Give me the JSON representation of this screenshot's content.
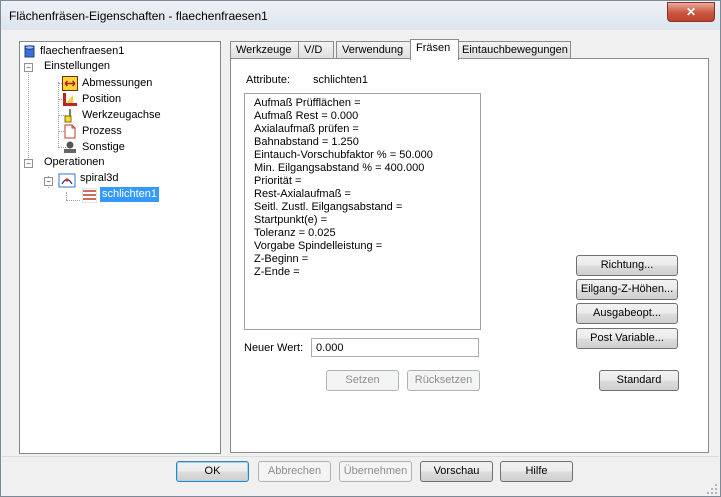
{
  "window": {
    "title": "Flächenfräsen-Eigenschaften - flaechenfraesen1",
    "close_symbol": "✕"
  },
  "tree": {
    "root": "flaechenfraesen1",
    "settings": "Einstellungen",
    "settings_items": [
      "Abmessungen",
      "Position",
      "Werkzeugachse",
      "Prozess",
      "Sonstige"
    ],
    "operations": "Operationen",
    "op_child": "spiral3d",
    "op_grandchild": "schlichten1",
    "expander_minus": "−"
  },
  "tabs": [
    "Werkzeuge",
    "V/D",
    "Verwendung",
    "Fräsen",
    "Eintauchbewegungen"
  ],
  "active_tab_index": 3,
  "attribute": {
    "label": "Attribute:",
    "value": "schlichten1"
  },
  "attributes_list": [
    "Aufmaß Prüfflächen =",
    "Aufmaß Rest = 0.000",
    "Axialaufmaß prüfen =",
    "Bahnabstand = 1.250",
    "Eintauch-Vorschubfaktor % = 50.000",
    "Min. Eilgangsabstand % = 400.000",
    "Priorität =",
    "Rest-Axialaufmaß =",
    "Seitl. Zustl. Eilgangsabstand =",
    "Startpunkt(e) =",
    "Toleranz = 0.025",
    "Vorgabe Spindelleistung =",
    "Z-Beginn =",
    "Z-Ende ="
  ],
  "new_value": {
    "label": "Neuer Wert:",
    "value": "0.000"
  },
  "buttons": {
    "setzen": "Setzen",
    "ruecksetzen": "Rücksetzen",
    "richtung": "Richtung...",
    "eilgang": "Eilgang-Z-Höhen...",
    "ausgabe": "Ausgabeopt...",
    "post": "Post Variable...",
    "standard": "Standard"
  },
  "footer": {
    "ok": "OK",
    "cancel": "Abbrechen",
    "apply": "Übernehmen",
    "preview": "Vorschau",
    "help": "Hilfe"
  },
  "colors": {
    "selection": "#3399ff",
    "close": "#c7553f",
    "default_button_border": "#3c7fb1"
  }
}
